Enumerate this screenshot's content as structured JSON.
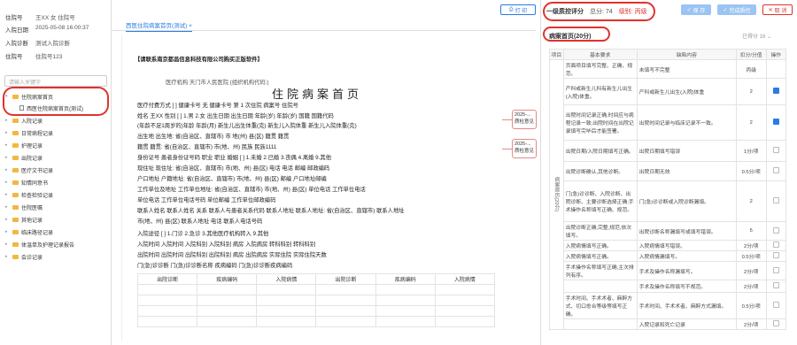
{
  "patient": {
    "fields": [
      {
        "label": "住院号",
        "value": "王XX  女  住院号"
      },
      {
        "label": "入院日期",
        "value": "2025-05-08 16:00:37"
      },
      {
        "label": "入院诊断",
        "value": "测试入院诊断"
      },
      {
        "label": "住院号",
        "value": "住院号123"
      }
    ]
  },
  "search_placeholder": "请输入关键字",
  "tree": [
    {
      "label": "住院病案首页",
      "type": "folder",
      "open": true
    },
    {
      "label": "西医住院病案首页(测试)",
      "type": "doc"
    },
    {
      "label": "入院记录",
      "type": "folder"
    },
    {
      "label": "日常病程记录",
      "type": "folder"
    },
    {
      "label": "护理记录",
      "type": "folder"
    },
    {
      "label": "出院记录",
      "type": "folder"
    },
    {
      "label": "医疗文书记录",
      "type": "folder"
    },
    {
      "label": "知情同意书",
      "type": "folder"
    },
    {
      "label": "检查检验记录",
      "type": "folder"
    },
    {
      "label": "住院医嘱",
      "type": "folder"
    },
    {
      "label": "其他记录",
      "type": "folder"
    },
    {
      "label": "临床路径记录",
      "type": "folder"
    },
    {
      "label": "体温单及护理记录报告",
      "type": "folder"
    },
    {
      "label": "会诊记录",
      "type": "folder"
    }
  ],
  "tab_label": "西医住院病案首页(测试)",
  "print_btn": "打 印",
  "doc": {
    "watermark": "【请联系南京都昌信息科技有限公司购买正版软件】",
    "org_line": "医疗机构 天门市人民医院        (组织机构代码:)",
    "title": "住院病案首页",
    "pay_line": "医疗付费方式 [ ]    健康卡号 无 健康卡号     第 1 次住院     病案号 住院号",
    "lines": [
      "姓名 王XX  性别 [ ] 1.男 2.女  出生日期 出生日期  年龄(岁) 年龄(岁)  国籍 国籍代码",
      "(年龄不足1周岁的)年龄 年龄(月) 新生儿出生体重(克) 新生儿入院体重 新生儿入院体重(克)",
      "出生地 出生地: 省(自治区、直辖市) 市 地(州) 县(区)  籍贯 籍贯",
      "籍贯 籍贯: 省(自治区、直辖市) 市(地、州)  民族 民族1111",
      "身份证号 患者身份证号码  职业 职业  婚姻 [ ] 1.未婚 2.已婚 3.丧偶 4.离婚 9.其他",
      "现住址 现住址: 省(自治区、直辖市) 市(地、州) 县(区) 电话 电话  邮编 邮政编码",
      "户口地址 户籍地址: 省(自治区、直辖市) 市(地、州) 县(区)  邮编 户口地址邮编",
      "工作单位及地址 工作单位地址: 省(自治区、直辖市) 市(地、州) 县(区)  单位电话 工作单位电话",
      "单位电话 工作单位电话号码  单位邮编 工作单位邮政编码",
      "联系人姓名 联系人姓名  关系 联系人与患者关系代码  联系人地址 联系人地址: 省(自治区、直辖市) 联系人地址",
      "市(地、州) 县(区) 联系人地址 电话 联系人电话号码",
      "入院途径 [ ] 1.门诊 2.急诊 3.其他医疗机构转入 9.其他",
      "入院时间 入院时间  入院科别 入院科别  病房 入院病房  转科科别 转科科别",
      "出院时间 出院时间  出院科别 出院科别  病房 出院病房  实际住院 实际住院天数",
      "门(急)诊诊断 门(急)诊诊断名称  疾病编码 门(急)诊诊断疾病编码"
    ],
    "diag_headers": [
      "出院诊断",
      "疾病编码",
      "入院病情",
      "出院诊断",
      "疾病编码",
      "入院病情"
    ]
  },
  "notes": [
    "2025-... 质检意见",
    "2025-... 质检意见"
  ],
  "score": {
    "title": "一级质控评分",
    "score_label": "总分: 74",
    "level_label": "级别: 丙级"
  },
  "buttons": {
    "save": "保 存",
    "done": "完成质控",
    "cancel": "取 消"
  },
  "section": {
    "title": "病案首页(20分)",
    "scored": "已得分 16"
  },
  "table": {
    "headers": [
      "项目",
      "基本要求",
      "缺陷内容",
      "扣分/分值",
      "操作"
    ],
    "group": "病案首页(20分)",
    "rows": [
      {
        "req": "页面项目填写完整、正确、规范。",
        "defect": "未填写不完整",
        "score": "丙级",
        "cb": "none"
      },
      {
        "req": "产科或新生儿科有新生儿出生(入院)体重。",
        "defect": "产科或新生儿出生(入院)体重",
        "score": "2",
        "cb": "on"
      },
      {
        "req": "出院时间记录正确,时间应与病程记录一致;出院时间在出院记录填写完毕后才能签署。",
        "defect": "出院时间记录与临床记录不一致。",
        "score": "2",
        "cb": "on"
      },
      {
        "req": "出院日期/入院日期填写正确。",
        "defect": "出院日期填写错误",
        "score": "1分/项",
        "cb": "off"
      },
      {
        "req": "出院诊断确认,其他诊断。",
        "defect": "出院日期无效",
        "score": "0.5分/项",
        "cb": "off"
      },
      {
        "req": "门(急)诊诊断、入院诊断、出院诊断、主要诊断选择正确;手术操作名称填写正确、规范。",
        "defect": "门(急)诊诊断或入院诊断漏填。",
        "score": "2",
        "cb": "off"
      },
      {
        "req": "出院诊断正确,完整,规范,依次填写。",
        "defect": "出院诊断名称漏填写或填写错误。",
        "score": "5",
        "cb": "off"
      },
      {
        "req": "入院病情填写正确。",
        "defect": "入院病情填写错误。",
        "score": "2分/项",
        "cb": "off"
      },
      {
        "req": "入院病情填写正确。",
        "defect": "入院病情漏填写。",
        "score": "0.5分/项",
        "cb": "off"
      },
      {
        "req": "手术操作名称填写正确,主次排列有序。",
        "defect": "手术及操作名称漏填写。",
        "score": "2分/项",
        "cb": "off"
      },
      {
        "req": "",
        "defect": "手术及操作名称填写不规范。",
        "score": "2分/项",
        "cb": "off"
      },
      {
        "req": "手术时间、手术术者、麻醉方式、切口愈合等级等填写正确。",
        "defect": "手术时间、手术术者、麻醉方式漏填。",
        "score": "0.5分/项",
        "cb": "off"
      },
      {
        "req": "",
        "defect": "入院记录和死亡记录",
        "score": "2分/项",
        "cb": "off"
      }
    ]
  }
}
